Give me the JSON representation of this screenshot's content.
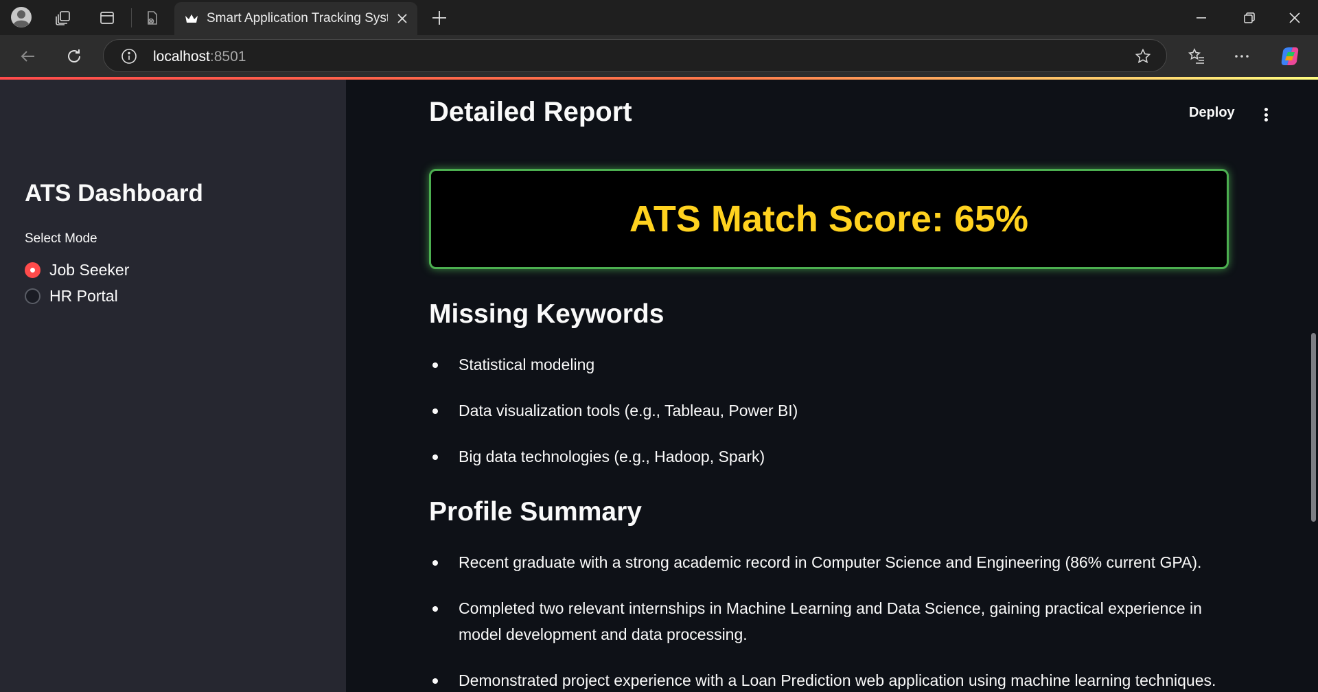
{
  "browser": {
    "tab_title": "Smart Application Tracking System",
    "url_host": "localhost",
    "url_port": ":8501"
  },
  "sidebar": {
    "title": "ATS Dashboard",
    "mode_label": "Select Mode",
    "options": [
      {
        "label": "Job Seeker",
        "selected": true
      },
      {
        "label": "HR Portal",
        "selected": false
      }
    ]
  },
  "header": {
    "deploy_label": "Deploy"
  },
  "main": {
    "title": "Detailed Report",
    "score_text": "ATS Match Score: 65%",
    "missing_keywords": {
      "heading": "Missing Keywords",
      "items": [
        "Statistical modeling",
        "Data visualization tools (e.g., Tableau, Power BI)",
        "Big data technologies (e.g., Hadoop, Spark)"
      ]
    },
    "profile_summary": {
      "heading": "Profile Summary",
      "items": [
        "Recent graduate with a strong academic record in Computer Science and Engineering (86% current GPA).",
        "Completed two relevant internships in Machine Learning and Data Science, gaining practical experience in model development and data processing.",
        "Demonstrated project experience with a Loan Prediction web application using machine learning techniques."
      ]
    }
  },
  "colors": {
    "accent": "#ff4b4b",
    "score": "#ffd21f",
    "score_border": "#4caf50",
    "sidebar_bg": "#262730",
    "main_bg": "#0e1117"
  }
}
